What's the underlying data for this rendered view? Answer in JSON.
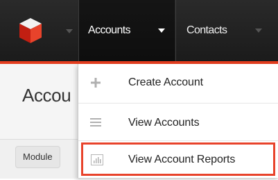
{
  "navbar": {
    "logo_icon": "sugar-cube-icon",
    "tabs": [
      {
        "label": "Accounts",
        "active": true
      },
      {
        "label": "Contacts",
        "active": false
      }
    ],
    "accent_color": "#e43d1e"
  },
  "page": {
    "title": "Accou",
    "filter": {
      "module_label": "Module"
    }
  },
  "dropdown": {
    "items": [
      {
        "label": "Create Account",
        "icon": "plus-icon"
      },
      {
        "label": "View Accounts",
        "icon": "list-icon"
      },
      {
        "label": "View Account Reports",
        "icon": "bar-chart-icon",
        "highlighted": true
      }
    ]
  },
  "colors": {
    "highlight": "#e8432b",
    "navbar": "#1f1f1f"
  }
}
